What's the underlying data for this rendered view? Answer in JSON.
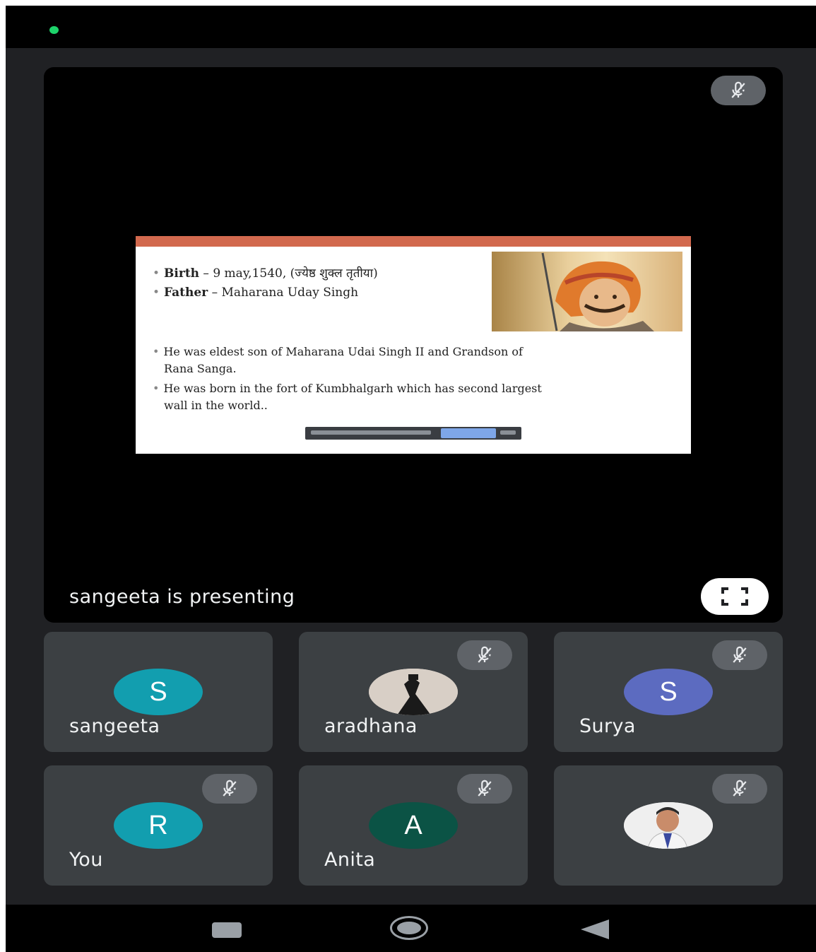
{
  "presentation": {
    "presenting_label": "sangeeta is presenting",
    "slide": {
      "line1_bold": "Birth",
      "line1_rest": " – 9 may,1540, (ज्येष्ठ शुक्ल तृतीया)",
      "line2_bold": "Father",
      "line2_rest": " – Maharana Uday Singh",
      "line3": "He was eldest son of Maharana Udai Singh II and Grandson of",
      "line4": "Rana Sanga.",
      "line5": "He was born in the fort of Kumbhalgarh which has second largest",
      "line6": "wall in the world.."
    }
  },
  "participants": [
    {
      "name": "sangeeta",
      "initial": "S",
      "avatar_color": "#129eaf",
      "muted": false
    },
    {
      "name": "aradhana",
      "initial": "",
      "avatar_color": "#cfc6bf",
      "muted": true
    },
    {
      "name": "Surya",
      "initial": "S",
      "avatar_color": "#5c6bc0",
      "muted": true
    },
    {
      "name": "You",
      "initial": "R",
      "avatar_color": "#129eaf",
      "muted": true
    },
    {
      "name": "Anita",
      "initial": "A",
      "avatar_color": "#0b5345",
      "muted": true
    },
    {
      "name": "",
      "initial": "",
      "avatar_color": "#e8e8e8",
      "muted": true
    }
  ],
  "icons": {
    "mute": "mic-off-icon",
    "fullscreen": "fullscreen-icon",
    "nav_recent": "recent-apps-icon",
    "nav_home": "home-icon",
    "nav_back": "back-icon"
  }
}
